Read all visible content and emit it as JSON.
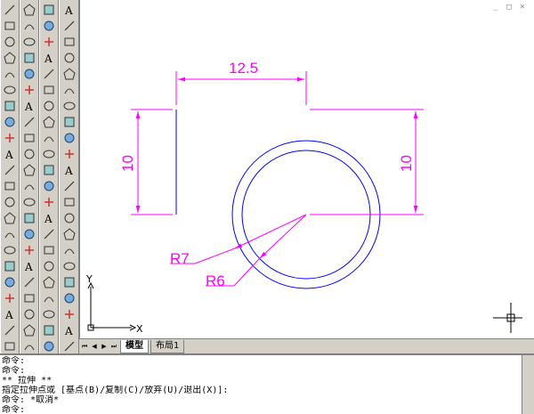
{
  "drawing": {
    "dim_horizontal": "12.5",
    "dim_left_vertical": "10",
    "dim_right_vertical": "10",
    "radius_outer": "R7",
    "radius_inner": "R6",
    "ucs_x": "X",
    "ucs_y": "Y"
  },
  "tabs": [
    {
      "label": "模型",
      "active": true
    },
    {
      "label": "布局1",
      "active": false
    }
  ],
  "window_controls": [
    "_",
    "□",
    "×"
  ],
  "command": {
    "lines": [
      "命令:",
      "命令:",
      "** 拉伸 **",
      "指定拉伸点或 [基点(B)/复制(C)/放弃(U)/退出(X)]:",
      "命令: *取消*",
      "命令:"
    ]
  },
  "colors": {
    "dimension": "#ff00ff",
    "geometry": "#0000ff",
    "ucs": "#000000",
    "toolbar": "#d4d0c8"
  },
  "toolbars": {
    "draw": [
      "line-icon",
      "construction-line-icon",
      "polyline-icon",
      "polygon-icon",
      "rectangle-icon",
      "arc-icon",
      "circle-icon",
      "revision-cloud-icon",
      "spline-icon",
      "ellipse-icon",
      "ellipse-arc-icon",
      "insert-block-icon",
      "make-block-icon",
      "point-icon",
      "hatch-icon",
      "gradient-icon",
      "region-icon",
      "table-icon",
      "mtext-icon",
      "boundary-icon",
      "wipeout-icon",
      "donut-icon"
    ],
    "modify": [
      "erase-icon",
      "copy-icon",
      "mirror-icon",
      "offset-icon",
      "array-icon",
      "move-icon",
      "rotate-icon",
      "scale-icon",
      "stretch-icon",
      "trim-icon",
      "extend-icon",
      "break-at-point-icon",
      "break-icon",
      "join-icon",
      "chamfer-icon",
      "fillet-icon",
      "explode-icon",
      "lengthen-icon",
      "align-icon",
      "measure-icon",
      "text-style-icon",
      "dim-style-icon"
    ],
    "solids": [
      "box-icon",
      "sphere-icon",
      "cylinder-icon",
      "cone-icon",
      "wedge-icon",
      "torus-icon",
      "extrude-icon",
      "revolve-icon",
      "section-icon",
      "slice-icon",
      "interfere-icon",
      "setup-icon",
      "union-icon",
      "subtract-icon",
      "intersect-icon",
      "flatshot-icon",
      "sweep-icon",
      "loft-icon",
      "planar-icon",
      "polysolid-icon",
      "text-align-icon",
      "render-icon"
    ],
    "view": [
      "view-top-icon",
      "view-bottom-icon",
      "view-left-icon",
      "view-right-icon",
      "view-front-icon",
      "view-back-icon",
      "view-sw-icon",
      "view-se-icon",
      "view-ne-icon",
      "view-nw-icon",
      "camera-icon",
      "orbit-icon",
      "walk-icon",
      "fly-icon",
      "zoom-window-icon",
      "zoom-extents-icon",
      "pan-icon",
      "3d-orbit-icon",
      "properties-icon",
      "text-icon",
      "visual-style-icon",
      "materials-icon"
    ]
  }
}
